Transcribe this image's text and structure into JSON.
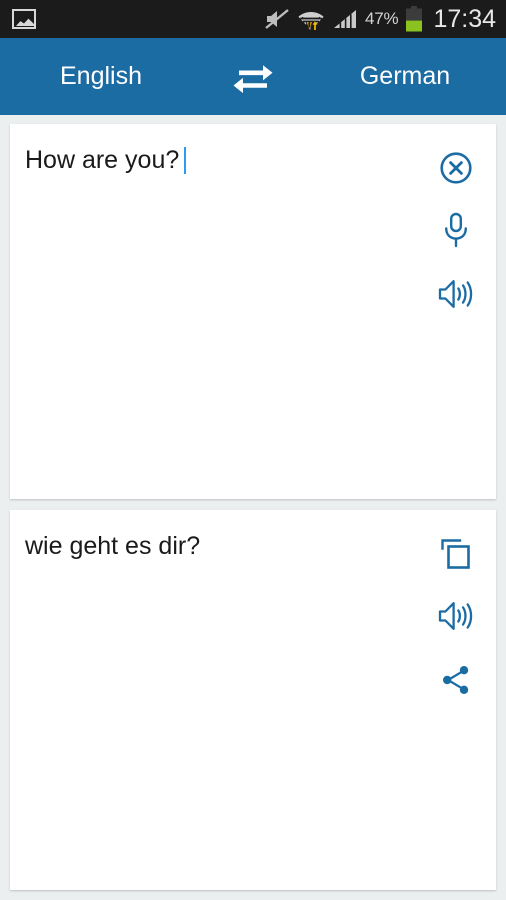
{
  "status_bar": {
    "left_icons": [
      {
        "name": "photo-icon",
        "label": "image"
      }
    ],
    "right_icons": [
      {
        "name": "mute-icon",
        "label": "sound off"
      },
      {
        "name": "wifi-data-icon",
        "label": "wifi with data transfer"
      },
      {
        "name": "signal-icon",
        "label": "cellular signal"
      }
    ],
    "battery_percent": "47%",
    "battery_level": 47,
    "time": "17:34",
    "background_color": "#1b1b1b",
    "text_color": "#d9d9d9"
  },
  "header": {
    "source_language": "English",
    "target_language": "German",
    "swap_icon": "swap-horizontal-icon",
    "background_color": "#1c6ca4",
    "text_color": "#ffffff"
  },
  "input_card": {
    "text": "How are you?",
    "has_caret": true,
    "actions": [
      {
        "name": "clear-button",
        "icon": "close-circle-icon",
        "label": "Clear"
      },
      {
        "name": "voice-input-button",
        "icon": "microphone-icon",
        "label": "Speak"
      },
      {
        "name": "speak-source-button",
        "icon": "volume-icon",
        "label": "Listen"
      }
    ]
  },
  "output_card": {
    "text": "wie geht es dir?",
    "actions": [
      {
        "name": "copy-button",
        "icon": "copy-icon",
        "label": "Copy"
      },
      {
        "name": "speak-target-button",
        "icon": "volume-icon",
        "label": "Listen"
      },
      {
        "name": "share-button",
        "icon": "share-icon",
        "label": "Share"
      }
    ]
  },
  "theme": {
    "accent": "#1c6ca4",
    "icon_color": "#1c6ca4",
    "page_background": "#eceff0",
    "card_background": "#ffffff",
    "caret_color": "#2e9bf0"
  }
}
